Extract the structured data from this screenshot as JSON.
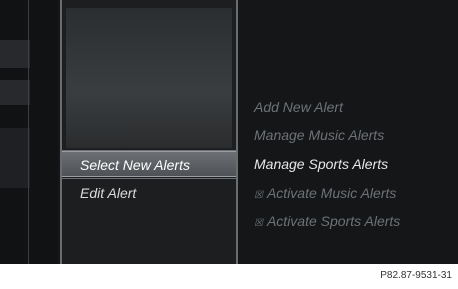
{
  "menu": {
    "items": [
      {
        "label": "Select New Alerts",
        "selected": true
      },
      {
        "label": "Edit Alert",
        "selected": false
      }
    ]
  },
  "submenu": {
    "items": [
      {
        "label": "Add New Alert",
        "active": false,
        "checkbox": false
      },
      {
        "label": "Manage Music Alerts",
        "active": false,
        "checkbox": false
      },
      {
        "label": "Manage Sports Alerts",
        "active": true,
        "checkbox": false
      },
      {
        "label": "Activate Music Alerts",
        "active": false,
        "checkbox": true
      },
      {
        "label": "Activate Sports Alerts",
        "active": false,
        "checkbox": true
      }
    ]
  },
  "footer": {
    "code": "P82.87-9531-31"
  },
  "colors": {
    "background": "#141618",
    "selected": "#5e6266",
    "text_active": "#e6e8ea",
    "text_dim": "#6e7276"
  }
}
